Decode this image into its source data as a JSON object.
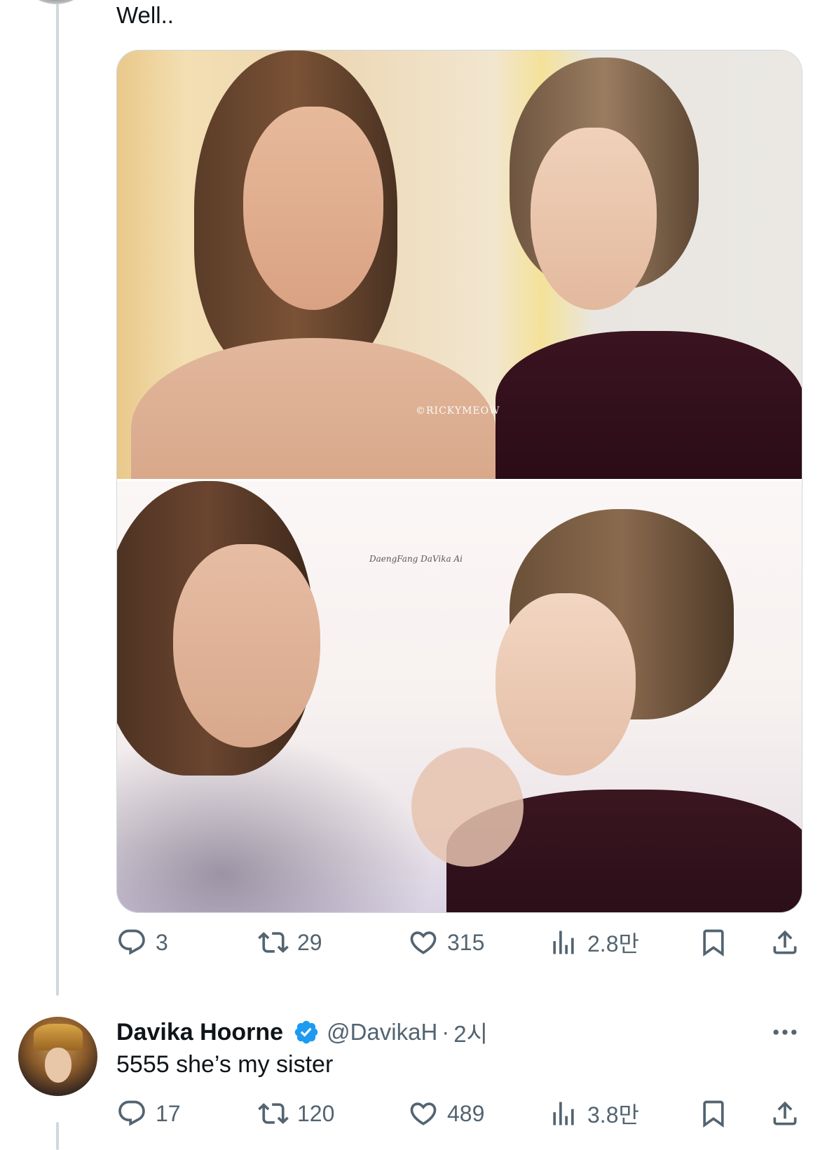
{
  "tweet": {
    "text": "Well..",
    "photos": [
      {
        "watermark": "©RICKYMEOW"
      },
      {
        "watermark": "DaengFang DaVika Ai"
      }
    ],
    "stats": {
      "replies": "3",
      "reposts": "29",
      "likes": "315",
      "views": "2.8만"
    }
  },
  "reply": {
    "name": "Davika Hoorne",
    "handle": "@DavikaH",
    "separator": "·",
    "time": "2시",
    "text": "5555 she’s my sister",
    "stats": {
      "replies": "17",
      "reposts": "120",
      "likes": "489",
      "views": "3.8만"
    }
  },
  "colors": {
    "text": "#0f1419",
    "secondary": "#536471",
    "thread_line": "#cfd9de",
    "verified_badge": "#1d9bf0"
  },
  "icons": [
    "reply-icon",
    "repost-icon",
    "like-icon",
    "views-icon",
    "bookmark-icon",
    "share-icon",
    "verified-badge-icon",
    "more-icon"
  ]
}
